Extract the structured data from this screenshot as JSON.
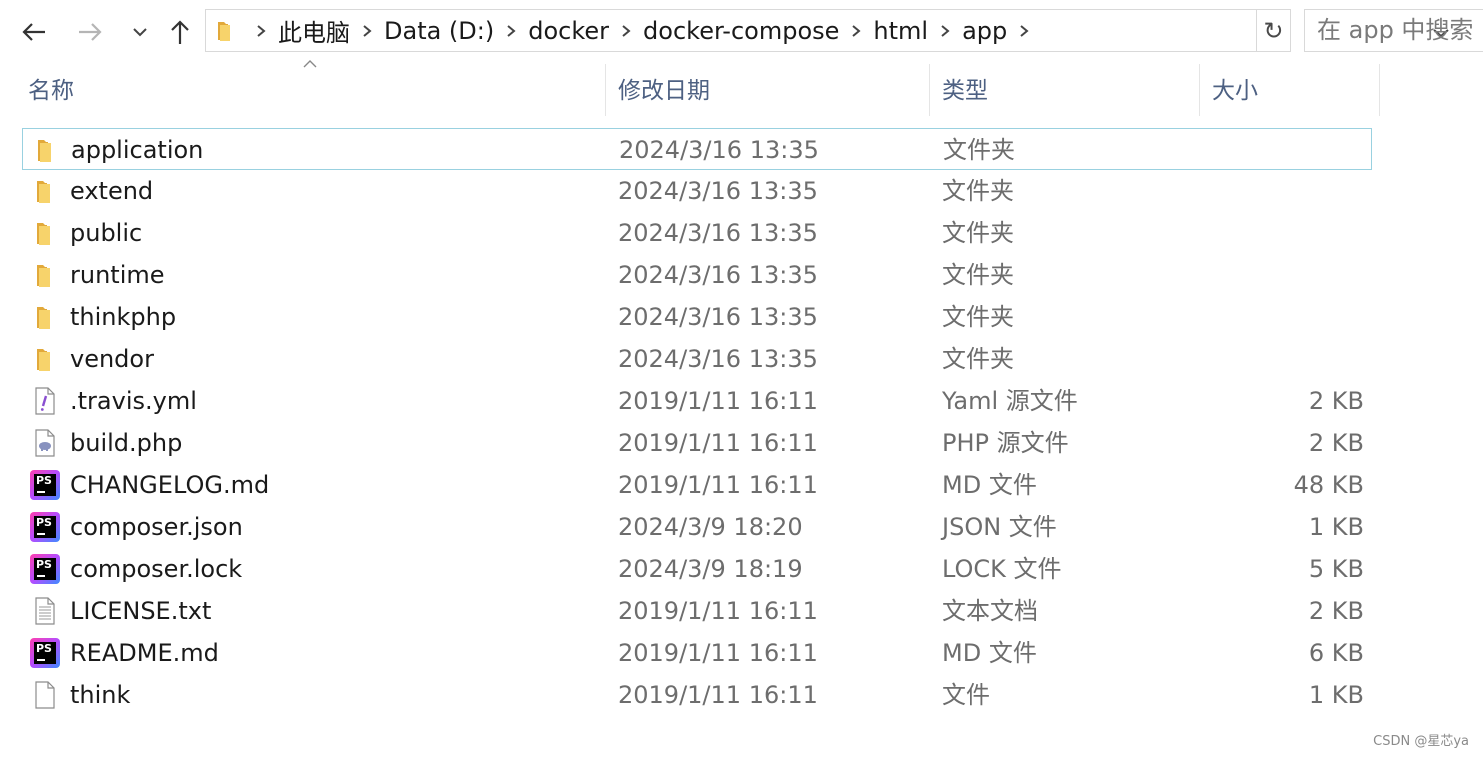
{
  "nav": {
    "crumbs": [
      "此电脑",
      "Data (D:)",
      "docker",
      "docker-compose",
      "html",
      "app"
    ],
    "search_placeholder": "在 app 中搜索",
    "refresh_glyph": "↻"
  },
  "columns": {
    "name": "名称",
    "date": "修改日期",
    "type": "类型",
    "size": "大小"
  },
  "files": [
    {
      "name": "application",
      "date": "2024/3/16 13:35",
      "type": "文件夹",
      "size": "",
      "icon": "folder-icon",
      "selected": true
    },
    {
      "name": "extend",
      "date": "2024/3/16 13:35",
      "type": "文件夹",
      "size": "",
      "icon": "folder-icon"
    },
    {
      "name": "public",
      "date": "2024/3/16 13:35",
      "type": "文件夹",
      "size": "",
      "icon": "folder-icon"
    },
    {
      "name": "runtime",
      "date": "2024/3/16 13:35",
      "type": "文件夹",
      "size": "",
      "icon": "folder-icon"
    },
    {
      "name": "thinkphp",
      "date": "2024/3/16 13:35",
      "type": "文件夹",
      "size": "",
      "icon": "folder-icon"
    },
    {
      "name": "vendor",
      "date": "2024/3/16 13:35",
      "type": "文件夹",
      "size": "",
      "icon": "folder-icon"
    },
    {
      "name": ".travis.yml",
      "date": "2019/1/11 16:11",
      "type": "Yaml 源文件",
      "size": "2 KB",
      "icon": "yaml-file-icon"
    },
    {
      "name": "build.php",
      "date": "2019/1/11 16:11",
      "type": "PHP 源文件",
      "size": "2 KB",
      "icon": "php-file-icon"
    },
    {
      "name": "CHANGELOG.md",
      "date": "2019/1/11 16:11",
      "type": "MD 文件",
      "size": "48 KB",
      "icon": "phpstorm-file-icon"
    },
    {
      "name": "composer.json",
      "date": "2024/3/9 18:20",
      "type": "JSON 文件",
      "size": "1 KB",
      "icon": "phpstorm-file-icon"
    },
    {
      "name": "composer.lock",
      "date": "2024/3/9 18:19",
      "type": "LOCK 文件",
      "size": "5 KB",
      "icon": "phpstorm-file-icon"
    },
    {
      "name": "LICENSE.txt",
      "date": "2019/1/11 16:11",
      "type": "文本文档",
      "size": "2 KB",
      "icon": "text-file-icon"
    },
    {
      "name": "README.md",
      "date": "2019/1/11 16:11",
      "type": "MD 文件",
      "size": "6 KB",
      "icon": "phpstorm-file-icon"
    },
    {
      "name": "think",
      "date": "2019/1/11 16:11",
      "type": "文件",
      "size": "1 KB",
      "icon": "blank-file-icon"
    }
  ],
  "ps_label": "PS",
  "watermark": "CSDN @星芯ya",
  "colors": {
    "header_text": "#4d6082",
    "selection_border": "#99d1e0",
    "folder": "#f5c84a"
  }
}
